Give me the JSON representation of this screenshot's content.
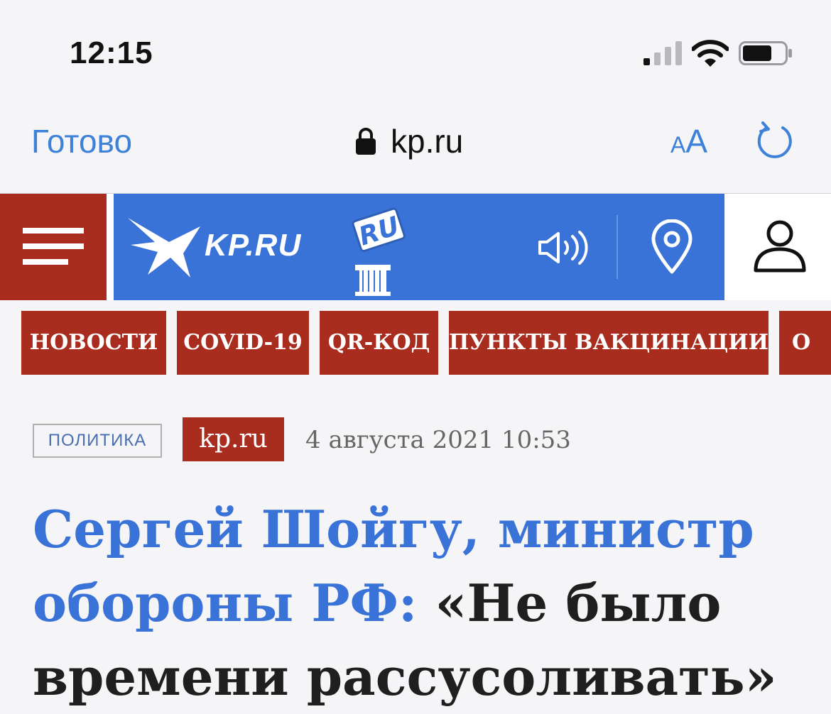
{
  "status_bar": {
    "time": "12:15"
  },
  "browser": {
    "done_label": "Готово",
    "url": "kp.ru",
    "text_size_small": "A",
    "text_size_big": "A",
    "reload_icon": "reload-icon"
  },
  "site": {
    "brand": "KP.RU",
    "badge": "RU",
    "accent_color": "#a92d1e",
    "brand_color": "#3a73d8"
  },
  "nav_tags": [
    {
      "label": "НОВОСТИ"
    },
    {
      "label": "COVID-19"
    },
    {
      "label": "QR-КОД"
    },
    {
      "label": "ПУНКТЫ ВАКЦИНАЦИИ"
    },
    {
      "label": "О"
    }
  ],
  "article": {
    "rubric": "ПОЛИТИКА",
    "source": "kp.ru",
    "date": "4 августа 2021 10:53",
    "headline_who": "Сергей Шойгу, министр обороны РФ:",
    "headline_quote": "«Не было времени рассусоливать»"
  }
}
